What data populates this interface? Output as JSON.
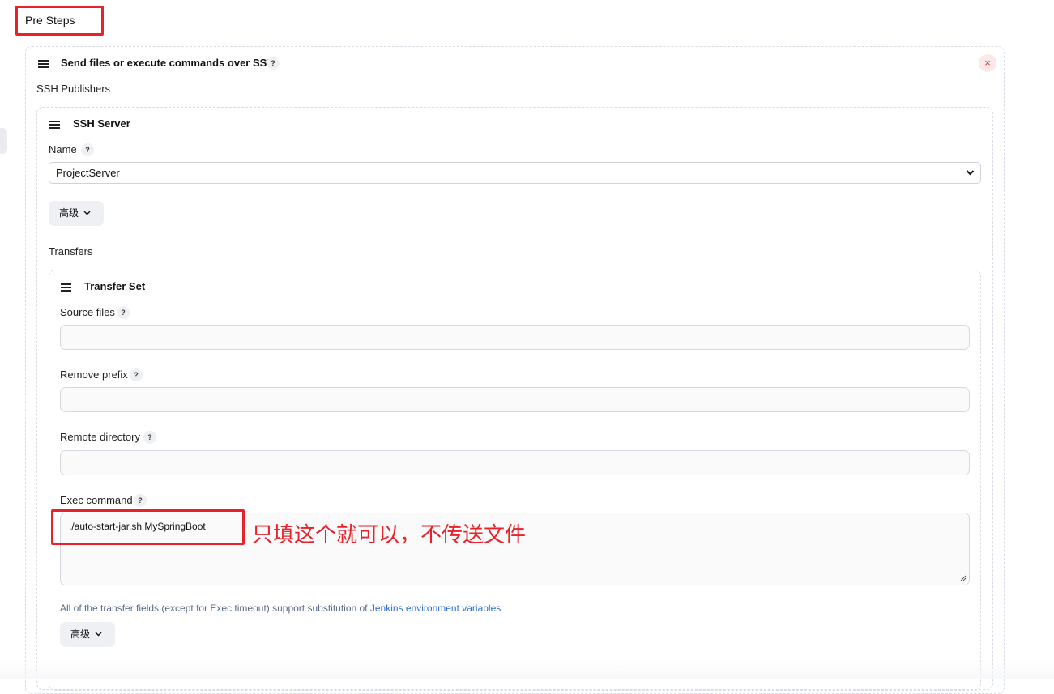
{
  "section": {
    "title": "Pre Steps"
  },
  "ssh_step": {
    "title": "Send files or execute commands over SSH",
    "help": "?",
    "close": "×",
    "publishers_label": "SSH Publishers"
  },
  "server": {
    "title": "SSH Server",
    "name_label": "Name",
    "help": "?",
    "selected": "ProjectServer",
    "advanced_label": "高级",
    "transfers_label": "Transfers"
  },
  "transfer": {
    "title": "Transfer Set",
    "source_files_label": "Source files",
    "source_files_value": "",
    "remove_prefix_label": "Remove prefix",
    "remove_prefix_value": "",
    "remote_directory_label": "Remote directory",
    "remote_directory_value": "",
    "exec_command_label": "Exec command",
    "exec_command_value": "./auto-start-jar.sh MySpringBoot",
    "help": "?",
    "hint_text": "All of the transfer fields (except for Exec timeout) support substitution of ",
    "hint_link": "Jenkins environment variables",
    "advanced_label": "高级"
  },
  "annotation": {
    "text": "只填这个就可以，不传送文件",
    "color": "#e8212a"
  },
  "icons": {
    "drag": "hamburger-icon",
    "chevron": "chevron-down-icon",
    "help": "help-icon",
    "close": "close-icon"
  }
}
